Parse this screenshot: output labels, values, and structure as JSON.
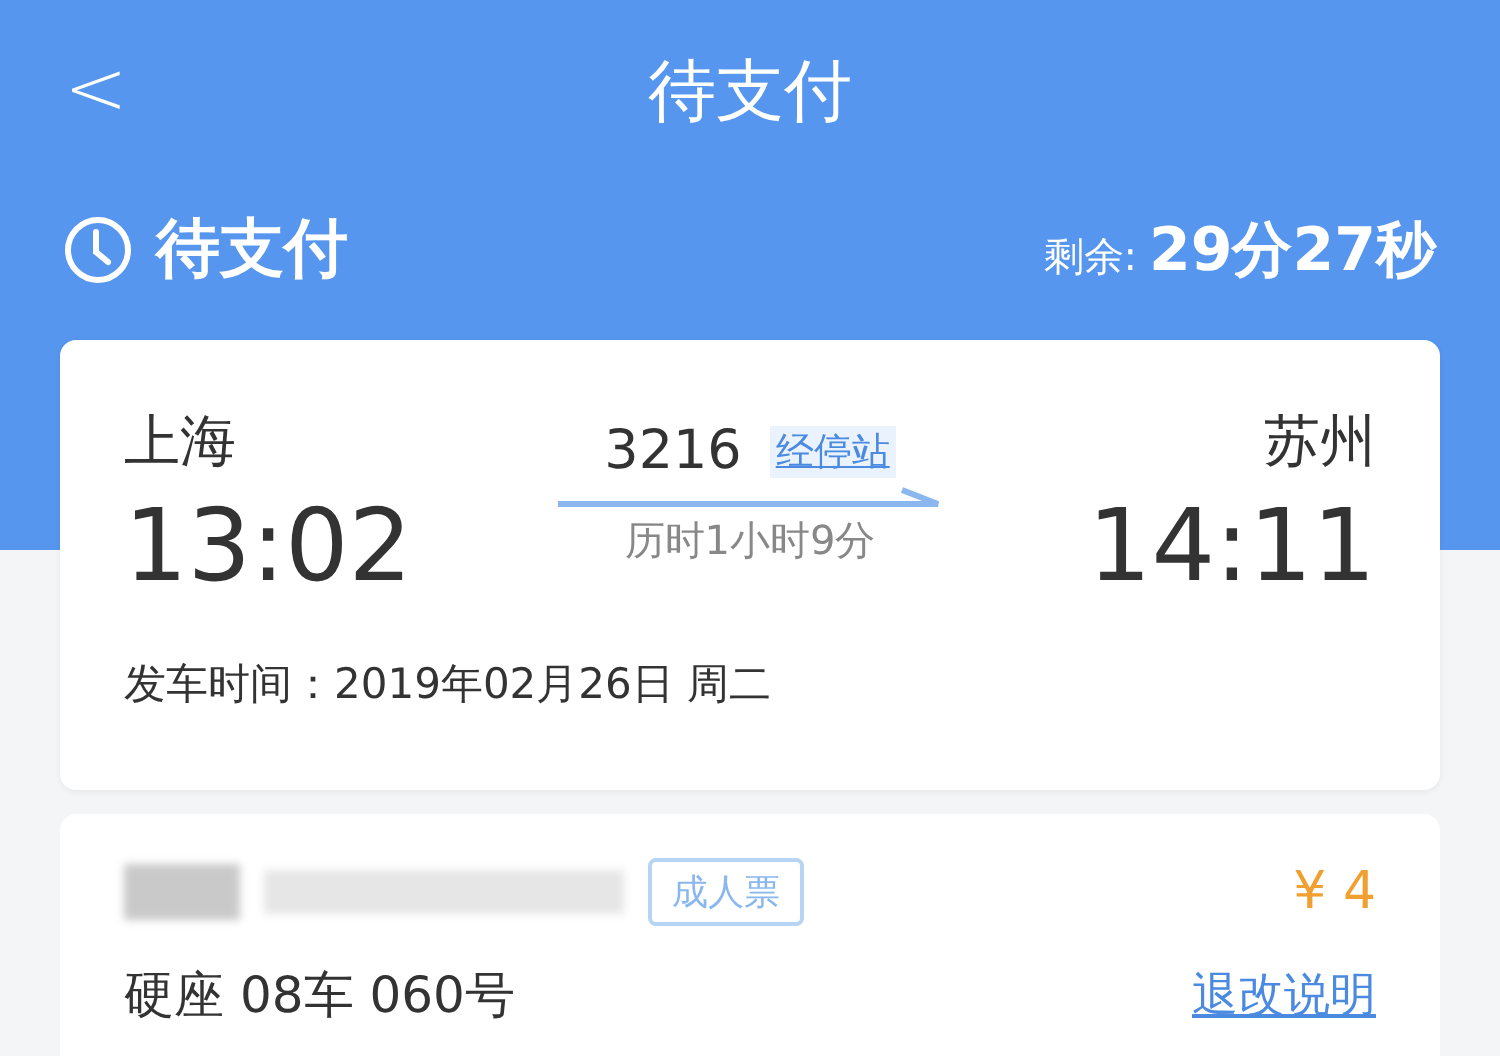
{
  "nav": {
    "back": "<",
    "title": "待支付"
  },
  "status": {
    "label": "待支付",
    "remaining_label": "剩余:",
    "remaining": "29分27秒"
  },
  "trip": {
    "from_station": "上海",
    "depart_time": "13:02",
    "train_no": "3216",
    "stops_link": "经停站",
    "duration": "历时1小时9分",
    "to_station": "苏州",
    "arrive_time": "14:11",
    "departure_date": "发车时间：2019年02月26日 周二"
  },
  "passengers": [
    {
      "name_redacted": true,
      "ticket_type": "成人票",
      "price": "¥ 4",
      "seat": "硬座 08车 060号",
      "refund_link": "退改说明"
    }
  ]
}
